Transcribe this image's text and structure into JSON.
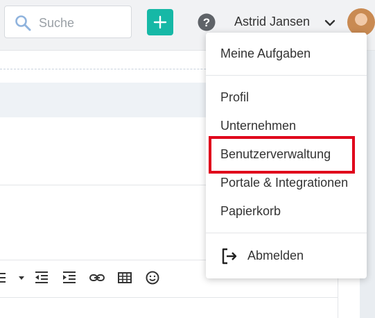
{
  "header": {
    "search_placeholder": "Suche",
    "user_name": "Astrid Jansen",
    "accent_color": "#16b8a6",
    "icons": [
      "search-icon",
      "plus-icon",
      "help-icon",
      "chevron-down-icon",
      "avatar"
    ]
  },
  "menu": {
    "items": [
      {
        "label": "Meine Aufgaben"
      },
      {
        "label": "Profil"
      },
      {
        "label": "Unternehmen"
      },
      {
        "label": "Benutzerverwaltung"
      },
      {
        "label": "Portale & Integrationen"
      },
      {
        "label": "Papierkorb"
      },
      {
        "label": "Abmelden"
      }
    ],
    "highlight_color": "#e0001b"
  },
  "editor_toolbar": {
    "icons": [
      "list-icon",
      "dropdown-caret-icon",
      "outdent-icon",
      "indent-icon",
      "link-icon",
      "table-icon",
      "emoji-icon"
    ]
  }
}
